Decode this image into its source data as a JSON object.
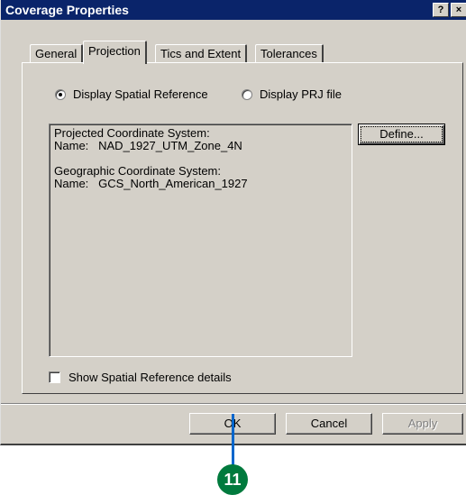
{
  "window": {
    "title": "Coverage Properties",
    "help_glyph": "?",
    "close_glyph": "×"
  },
  "tabs": [
    {
      "label": "General",
      "active": false
    },
    {
      "label": "Projection",
      "active": true
    },
    {
      "label": "Tics and Extent",
      "active": false
    },
    {
      "label": "Tolerances",
      "active": false
    }
  ],
  "display_mode": {
    "spatial_reference_label": "Display Spatial Reference",
    "spatial_reference_selected": true,
    "prj_file_label": "Display PRJ file",
    "prj_file_selected": false
  },
  "reference_text": {
    "line1": "Projected Coordinate System:",
    "line2": "Name:   NAD_1927_UTM_Zone_4N",
    "line3": "",
    "line4": "Geographic Coordinate System:",
    "line5": "Name:   GCS_North_American_1927"
  },
  "define_button_label": "Define...",
  "show_details": {
    "label": "Show Spatial Reference details",
    "checked": false
  },
  "footer": {
    "ok_label": "OK",
    "cancel_label": "Cancel",
    "apply_label": "Apply",
    "apply_enabled": false
  },
  "callout": {
    "step_number": "11",
    "color": "#007a3d",
    "leader_color": "#0066cc"
  },
  "colors": {
    "titlebar": "#0a246a",
    "dialog_face": "#d4d0c8"
  }
}
